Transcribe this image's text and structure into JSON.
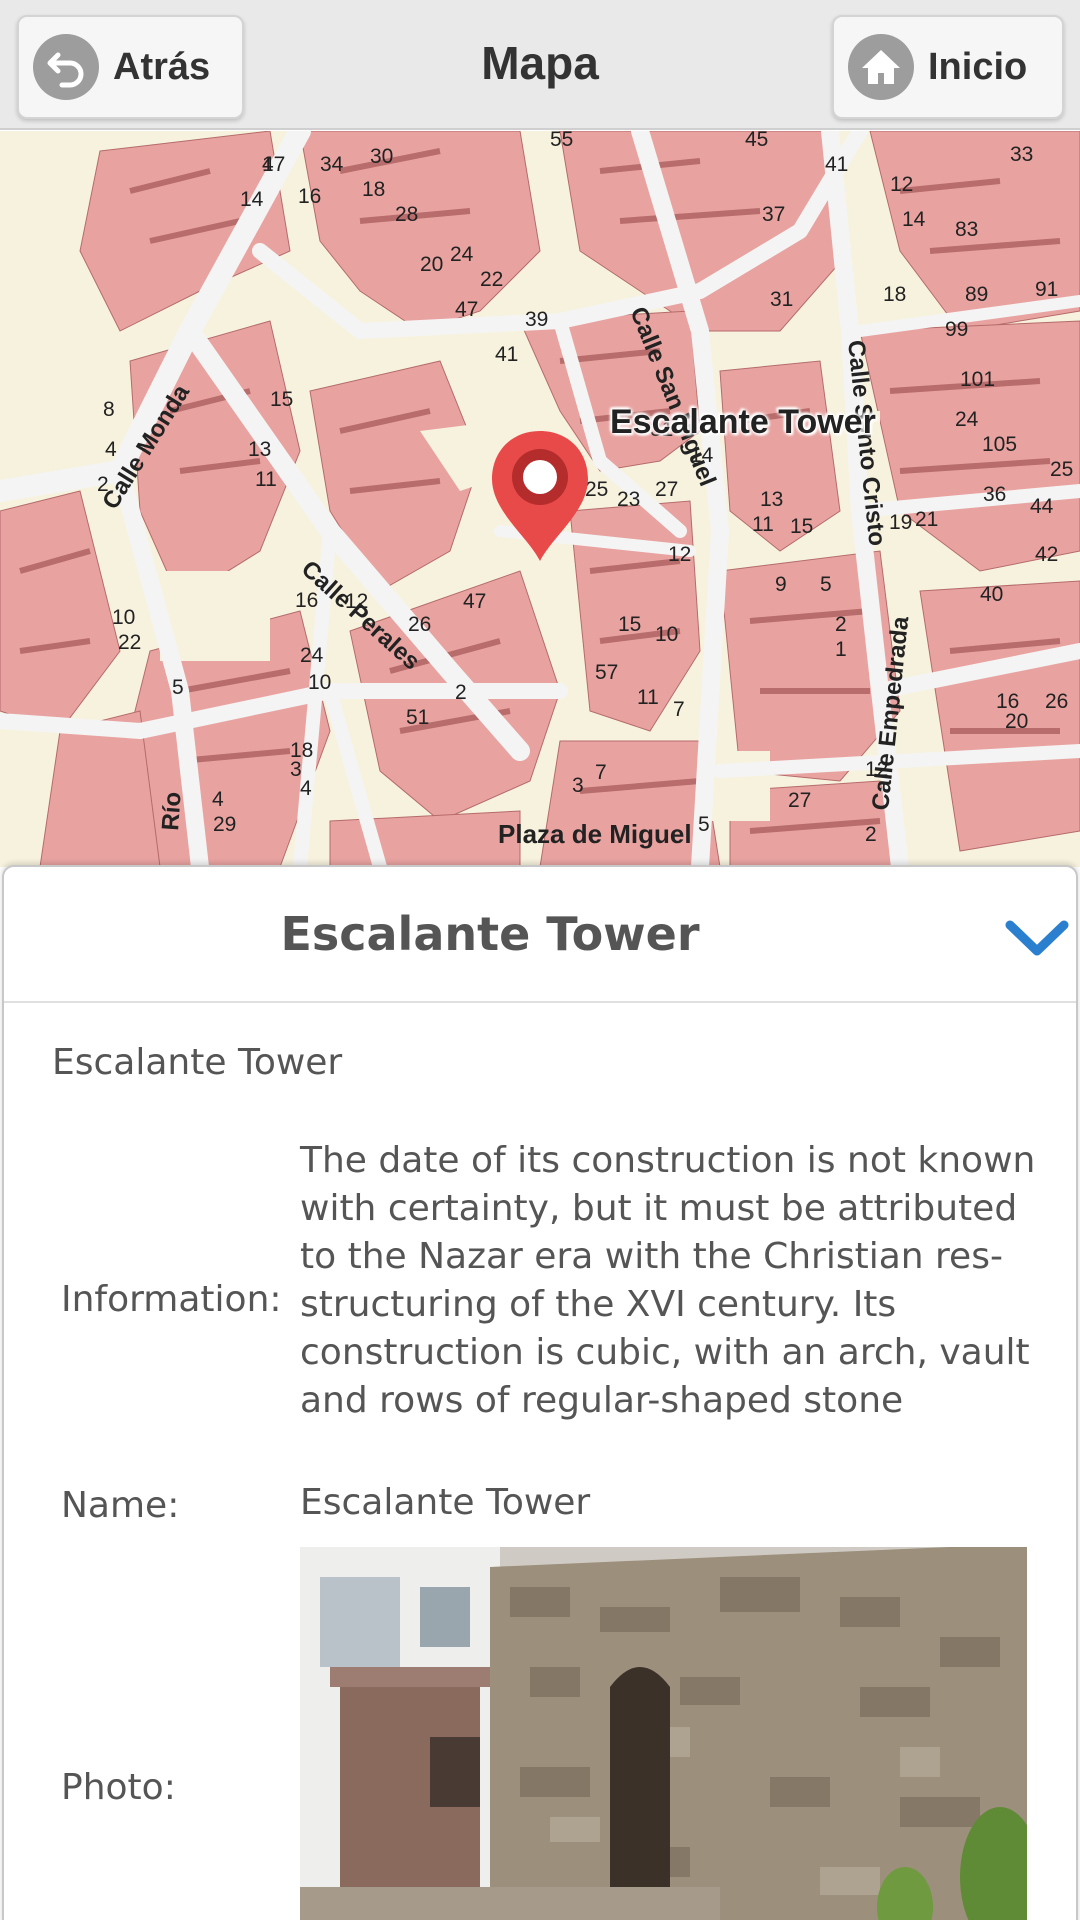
{
  "header": {
    "back_label": "Atrás",
    "title": "Mapa",
    "home_label": "Inicio"
  },
  "map": {
    "poi_label": "Escalante Tower",
    "streets": [
      "Calle Monda",
      "Calle Perales",
      "Calle San Miguel",
      "Calle Santo Cristo",
      "Calle Empedrada",
      "Río",
      "Plaza de Miguel"
    ],
    "house_numbers": [
      "17",
      "14",
      "16",
      "34",
      "30",
      "18",
      "28",
      "20",
      "24",
      "22",
      "47",
      "39",
      "41",
      "55",
      "45",
      "41",
      "33",
      "12",
      "14",
      "83",
      "37",
      "31",
      "18",
      "89",
      "91",
      "99",
      "101",
      "24",
      "105",
      "25",
      "8",
      "4",
      "2",
      "13",
      "15",
      "11",
      "25",
      "23",
      "14",
      "27",
      "31",
      "13",
      "11",
      "15",
      "19",
      "21",
      "36",
      "44",
      "42",
      "12",
      "9",
      "5",
      "40",
      "10",
      "22",
      "16",
      "12",
      "26",
      "47",
      "15",
      "10",
      "2",
      "1",
      "16",
      "20",
      "26",
      "24",
      "10",
      "5",
      "18",
      "3",
      "4",
      "2",
      "51",
      "57",
      "11",
      "7",
      "3",
      "4",
      "29",
      "27",
      "5",
      "2",
      "12",
      "7",
      "4"
    ]
  },
  "panel": {
    "title": "Escalante Tower",
    "subtitle": "Escalante Tower",
    "information_label": "Information:",
    "information_value": "The date of its construction is not known with certainty, but it must be attributed to the Nazar era with the Christian res-structuring of the XVI century. Its construction is cubic, with an arch, vault and rows of regular-shaped stone",
    "name_label": "Name:",
    "name_value": "Escalante Tower",
    "photo_label": "Photo:"
  },
  "colors": {
    "accent": "#2b7fcf",
    "building": "#e8a3a0",
    "building_shadow": "#a85a5a",
    "road": "#f4f4f4",
    "park": "#f7f2de",
    "marker": "#e84a4a"
  },
  "icons": {
    "back": "back-arrow-icon",
    "home": "home-icon",
    "collapse": "chevron-down-icon",
    "marker": "map-marker-icon"
  }
}
